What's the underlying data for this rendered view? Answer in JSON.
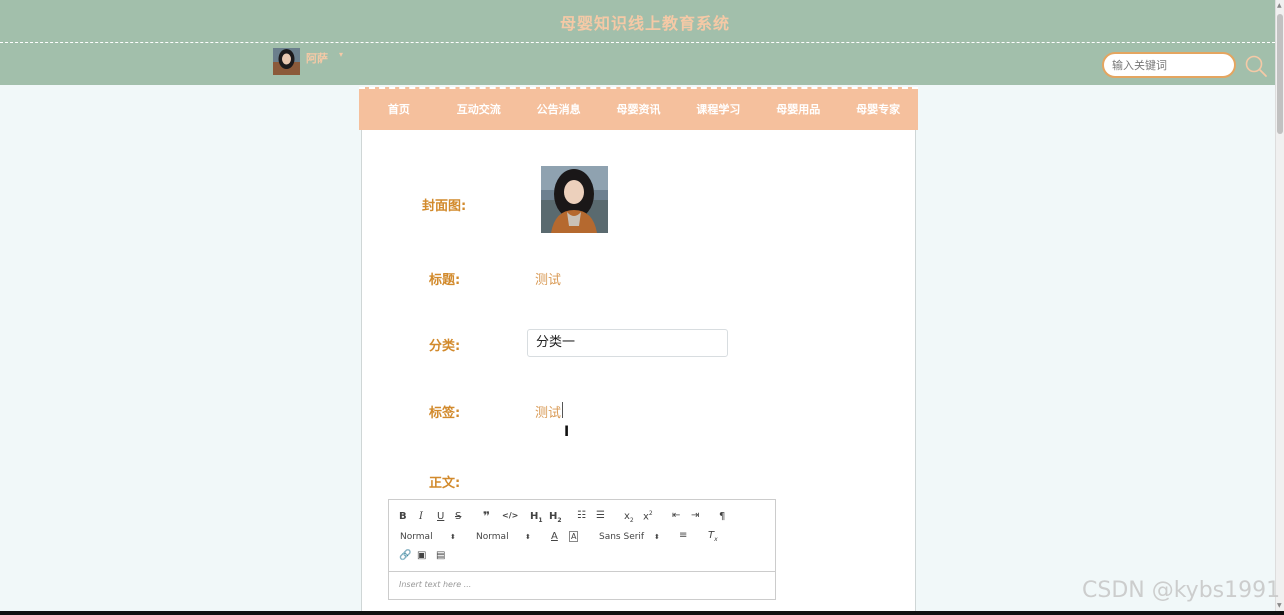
{
  "header": {
    "site_title": "母婴知识线上教育系统",
    "username": "阿萨",
    "caret": "▾",
    "search_placeholder": "输入关键词"
  },
  "nav": {
    "items": [
      "首页",
      "互动交流",
      "公告消息",
      "母婴资讯",
      "课程学习",
      "母婴用品",
      "母婴专家"
    ]
  },
  "form": {
    "cover_label": "封面图:",
    "title_label": "标题:",
    "title_value": "测试",
    "category_label": "分类:",
    "category_value": "分类一",
    "tags_label": "标签:",
    "tags_value": "测试",
    "body_label": "正文:"
  },
  "editor": {
    "header_select": "Normal",
    "size_select": "Normal",
    "font_select": "Sans Serif",
    "placeholder": "Insert text here ..."
  },
  "watermark": "CSDN @kybs1991",
  "colors": {
    "header_bg": "#a2bfab",
    "nav_bg": "#f5c09d",
    "label": "#d28a2c",
    "value": "#d99a55",
    "search_border": "#e4a560"
  }
}
